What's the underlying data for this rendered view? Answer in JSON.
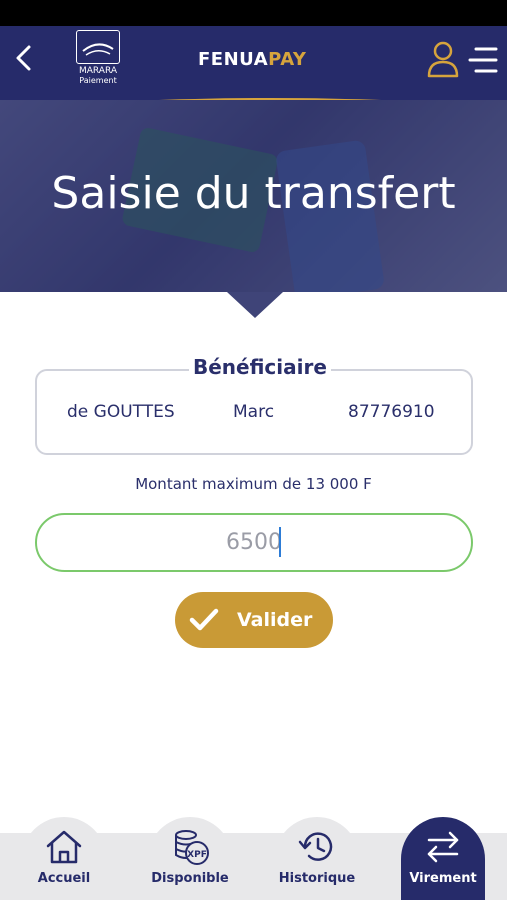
{
  "header": {
    "logo_line1": "MARARA",
    "logo_line2": "Paiement",
    "brand_part1": "FENUA",
    "brand_part2": "PAY"
  },
  "hero": {
    "title": "Saisie du transfert"
  },
  "beneficiary": {
    "legend": "Bénéficiaire",
    "last_name": "de GOUTTES",
    "first_name": "Marc",
    "phone": "87776910"
  },
  "amount": {
    "max_text": "Montant maximum de 13 000 F",
    "value": "6500"
  },
  "validate_label": "Valider",
  "nav": {
    "items": [
      {
        "label": "Accueil",
        "icon": "home-icon"
      },
      {
        "label": "Disponible",
        "icon": "coins-xpf-icon"
      },
      {
        "label": "Historique",
        "icon": "history-icon"
      },
      {
        "label": "Virement",
        "icon": "transfer-arrows-icon"
      }
    ]
  },
  "colors": {
    "navy": "#262b6a",
    "gold": "#d6a43d",
    "input_border": "#7bc96b"
  }
}
